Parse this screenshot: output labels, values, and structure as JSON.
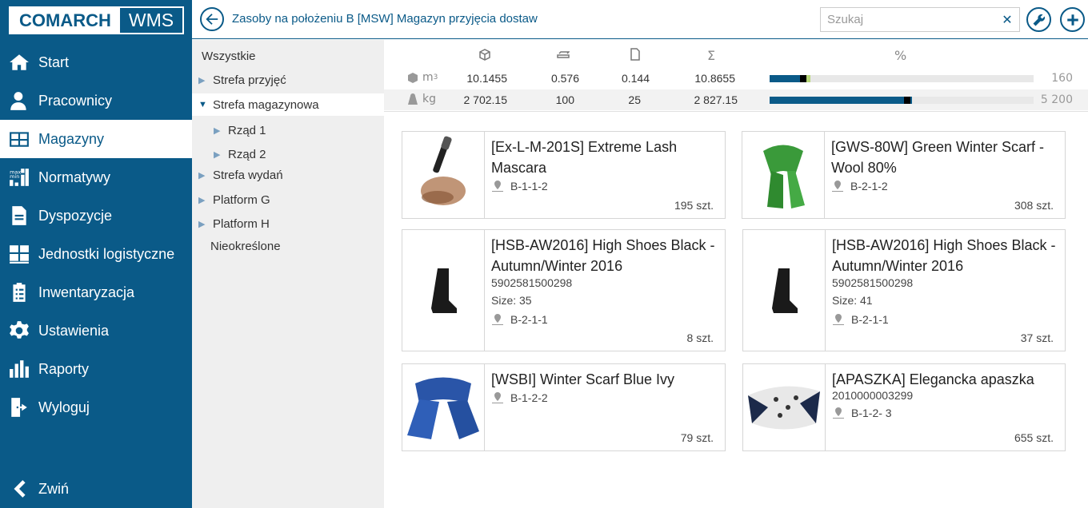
{
  "app": {
    "logo_left": "COMARCH",
    "logo_right": "WMS"
  },
  "nav": {
    "items": [
      {
        "label": "Start",
        "icon": "home-icon"
      },
      {
        "label": "Pracownicy",
        "icon": "user-icon"
      },
      {
        "label": "Magazyny",
        "icon": "warehouse-icon",
        "active": true
      },
      {
        "label": "Normatywy",
        "icon": "minmax-icon"
      },
      {
        "label": "Dyspozycje",
        "icon": "document-icon"
      },
      {
        "label": "Jednostki logistyczne",
        "icon": "pallet-icon"
      },
      {
        "label": "Inwentaryzacja",
        "icon": "clipboard-icon"
      },
      {
        "label": "Ustawienia",
        "icon": "gear-icon"
      },
      {
        "label": "Raporty",
        "icon": "chart-icon"
      },
      {
        "label": "Wyloguj",
        "icon": "logout-icon"
      }
    ],
    "collapse_label": "Zwiń"
  },
  "header": {
    "title": "Zasoby na położeniu B [MSW] Magazyn przyjęcia dostaw",
    "search_placeholder": "Szukaj"
  },
  "tree": {
    "items": [
      {
        "label": "Wszystkie",
        "arrow": ""
      },
      {
        "label": "Strefa przyjęć",
        "arrow": "▶"
      },
      {
        "label": "Strefa magazynowa",
        "arrow": "▼"
      },
      {
        "label": "Rząd 1",
        "arrow": "▶"
      },
      {
        "label": "Rząd 2",
        "arrow": "▶"
      },
      {
        "label": "Strefa wydań",
        "arrow": "▶"
      },
      {
        "label": "Platform G",
        "arrow": "▶"
      },
      {
        "label": "Platform H",
        "arrow": "▶"
      },
      {
        "label": "Nieokreślone",
        "arrow": ""
      }
    ]
  },
  "stats": {
    "percent_header": "%",
    "rows": [
      {
        "unit": "m",
        "sup": "3",
        "values": [
          "10.1455",
          "0.576",
          "0.144",
          "10.8655"
        ],
        "fill_pct": 13,
        "max": "160"
      },
      {
        "unit": "kg",
        "sup": "",
        "values": [
          "2 702.15",
          "100",
          "25",
          "2 827.15"
        ],
        "fill_pct": 54,
        "max": "5 200"
      }
    ]
  },
  "products": [
    {
      "title": "[Ex-L-M-201S] Extreme Lash Mascara",
      "ean": "",
      "size": "",
      "location": "B-1-1-2",
      "qty": "195 szt.",
      "image": "mascara"
    },
    {
      "title": "[GWS-80W] Green Winter Scarf - Wool 80%",
      "ean": "",
      "size": "",
      "location": "B-2-1-2",
      "qty": "308 szt.",
      "image": "green-scarf"
    },
    {
      "title": "[HSB-AW2016] High Shoes Black - Autumn/Winter 2016",
      "ean": "5902581500298",
      "size": "Size: 35",
      "location": "B-2-1-1",
      "qty": "8 szt.",
      "image": "boot"
    },
    {
      "title": "[HSB-AW2016] High Shoes Black - Autumn/Winter 2016",
      "ean": "5902581500298",
      "size": "Size: 41",
      "location": "B-2-1-1",
      "qty": "37 szt.",
      "image": "boot"
    },
    {
      "title": "[WSBI] Winter Scarf Blue Ivy",
      "ean": "",
      "size": "",
      "location": "B-1-2-2",
      "qty": "79 szt.",
      "image": "blue-scarf"
    },
    {
      "title": "[APASZKA] Elegancka apaszka",
      "ean": "2010000003299",
      "size": "",
      "location": "B-1-2- 3",
      "qty": "655 szt.",
      "image": "silk-scarf"
    }
  ]
}
